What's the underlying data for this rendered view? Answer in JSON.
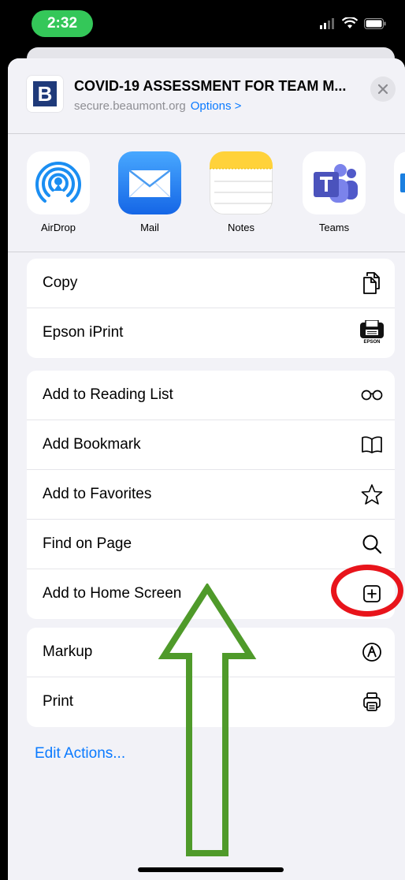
{
  "status": {
    "time": "2:32"
  },
  "header": {
    "site_letter": "B",
    "title": "COVID-19 ASSESSMENT FOR TEAM M...",
    "domain": "secure.beaumont.org",
    "options_label": "Options >"
  },
  "apps": [
    {
      "label": "AirDrop",
      "icon": "airdrop-icon"
    },
    {
      "label": "Mail",
      "icon": "mail-icon"
    },
    {
      "label": "Notes",
      "icon": "notes-icon"
    },
    {
      "label": "Teams",
      "icon": "teams-icon"
    }
  ],
  "group1": [
    {
      "label": "Copy",
      "icon": "copy-icon"
    },
    {
      "label": "Epson iPrint",
      "icon": "epson-printer-icon",
      "icon_text": "EPSON"
    }
  ],
  "group2": [
    {
      "label": "Add to Reading List",
      "icon": "glasses-icon"
    },
    {
      "label": "Add Bookmark",
      "icon": "book-icon"
    },
    {
      "label": "Add to Favorites",
      "icon": "star-icon"
    },
    {
      "label": "Find on Page",
      "icon": "search-icon"
    },
    {
      "label": "Add to Home Screen",
      "icon": "plus-square-icon"
    }
  ],
  "group3": [
    {
      "label": "Markup",
      "icon": "markup-pen-icon"
    },
    {
      "label": "Print",
      "icon": "printer-icon"
    }
  ],
  "edit_actions": "Edit Actions...",
  "colors": {
    "accent": "#0a7aff",
    "time_pill": "#34c759",
    "annotation_red": "#e8141b",
    "annotation_green": "#4f9a2a"
  }
}
